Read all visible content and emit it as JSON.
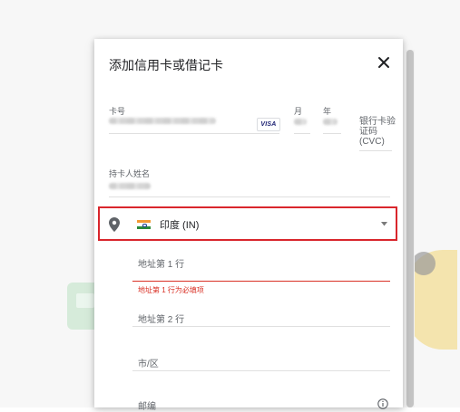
{
  "dialog": {
    "title": "添加信用卡或借记卡",
    "close_icon": "close-icon"
  },
  "card": {
    "number_label": "卡号",
    "brand": "VISA",
    "month_label": "月",
    "year_label": "年",
    "cvc_label": "银行卡验证码(CVC)"
  },
  "holder": {
    "name_label": "持卡人姓名"
  },
  "address": {
    "location_icon": "map-pin-icon",
    "country": "印度 (IN)",
    "line1_placeholder": "地址第 1 行",
    "line1_error": "地址第 1 行为必填项",
    "line2_placeholder": "地址第 2 行",
    "city_placeholder": "市/区",
    "postal_placeholder": "邮编"
  },
  "colors": {
    "highlight": "#d9262c",
    "error": "#d93025"
  }
}
